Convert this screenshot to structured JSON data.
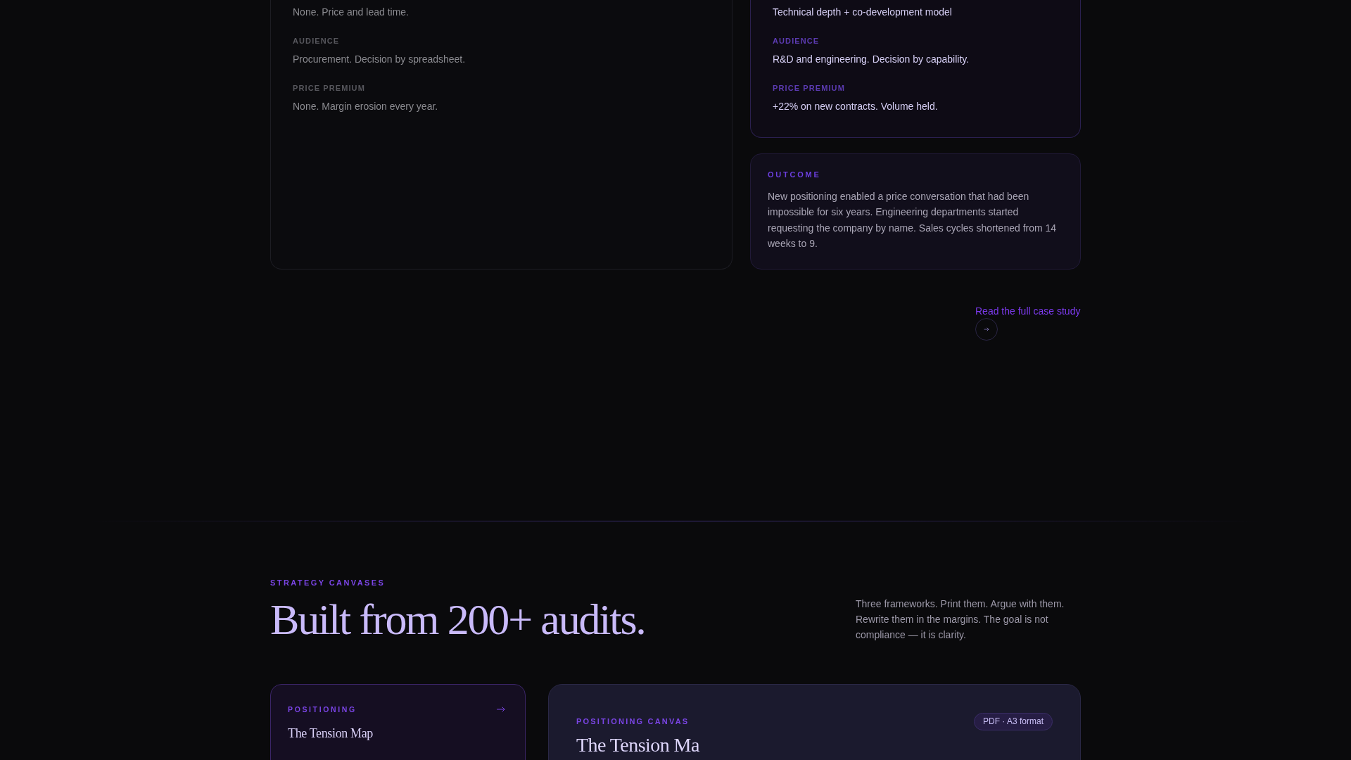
{
  "comparison": {
    "cards": [
      {
        "kind": "muted",
        "fields": [
          {
            "value": "None. Price and lead time."
          },
          {
            "label": "AUDIENCE",
            "value": "Procurement. Decision by spreadsheet."
          },
          {
            "label": "PRICE PREMIUM",
            "value": "None. Margin erosion every year."
          }
        ]
      },
      {
        "kind": "accent",
        "fields": [
          {
            "value": "Technical depth + co-development model"
          },
          {
            "label": "AUDIENCE",
            "value": "R&D and engineering. Decision by capability."
          },
          {
            "label": "PRICE PREMIUM",
            "value": "+22% on new contracts. Volume held."
          }
        ]
      }
    ],
    "outcome": {
      "label": "OUTCOME",
      "text": "New positioning enabled a price conversation that had been impossible for six years. Engineering departments started requesting the company by name. Sales cycles shortened from 14 weeks to 9."
    }
  },
  "case_study_link": {
    "label": "Read the full case study"
  },
  "strategy_canvases": {
    "eyebrow": "STRATEGY CANVASES",
    "title": "Built from 200+ audits.",
    "intro": "Three frameworks. Print them. Argue with them. Rewrite them in the margins. The goal is not compliance — it is clarity.",
    "canvases": [
      {
        "category": "POSITIONING",
        "title": "The Tension Map",
        "selected": true
      }
    ],
    "preview": {
      "label": "POSITIONING CANVAS",
      "badge": "PDF · A3 format",
      "title": "The Tension Ma"
    }
  }
}
